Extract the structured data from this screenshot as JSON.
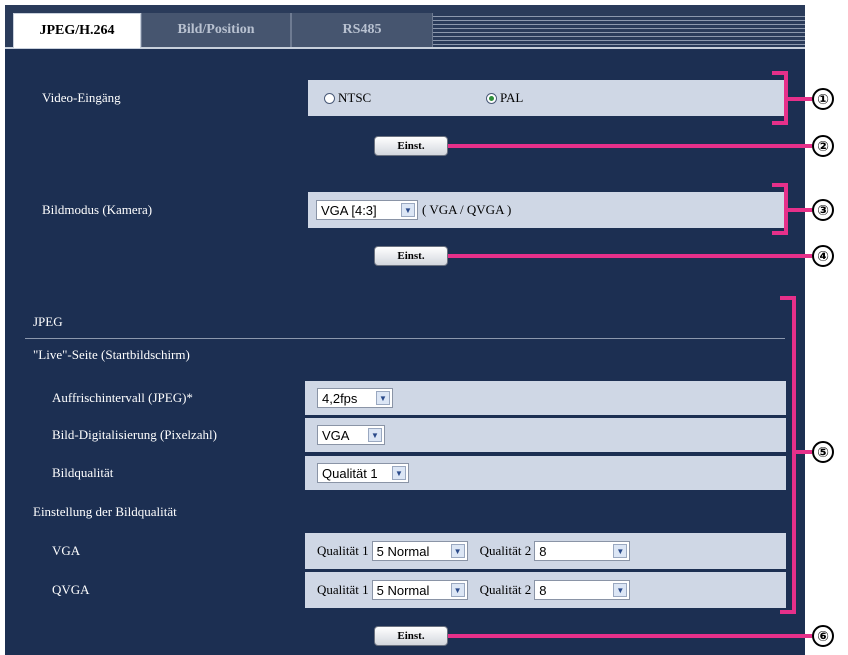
{
  "tabs": [
    {
      "label": "JPEG/H.264",
      "active": true
    },
    {
      "label": "Bild/Position",
      "active": false
    },
    {
      "label": "RS485",
      "active": false
    }
  ],
  "video_input": {
    "label": "Video-Eingäng",
    "options": [
      "NTSC",
      "PAL"
    ],
    "selected": "PAL"
  },
  "set_button_label": "Einst.",
  "image_mode": {
    "label": "Bildmodus (Kamera)",
    "value": "VGA [4:3]",
    "note": "( VGA / QVGA )"
  },
  "jpeg": {
    "header": "JPEG",
    "live_header": "\"Live\"-Seite (Startbildschirm)",
    "refresh": {
      "label": "Auffrischintervall (JPEG)*",
      "value": "4,2fps"
    },
    "resolution": {
      "label": "Bild-Digitalisierung (Pixelzahl)",
      "value": "VGA"
    },
    "quality": {
      "label": "Bildqualität",
      "value": "Qualität 1"
    },
    "quality_settings_header": "Einstellung der Bildqualität",
    "rows": [
      {
        "label": "VGA",
        "q1_label": "Qualität 1",
        "q1_value": "5 Normal",
        "q2_label": "Qualität 2",
        "q2_value": "8"
      },
      {
        "label": "QVGA",
        "q1_label": "Qualität 1",
        "q1_value": "5 Normal",
        "q2_label": "Qualität 2",
        "q2_value": "8"
      }
    ]
  },
  "callouts": [
    "①",
    "②",
    "③",
    "④",
    "⑤",
    "⑥"
  ],
  "colors": {
    "panel": "#1c2f52",
    "cell": "#cfd7e5",
    "annotation": "#e6308a"
  },
  "icons": {
    "dropdown": "chevron-down-icon",
    "radio": "radio-icon"
  }
}
